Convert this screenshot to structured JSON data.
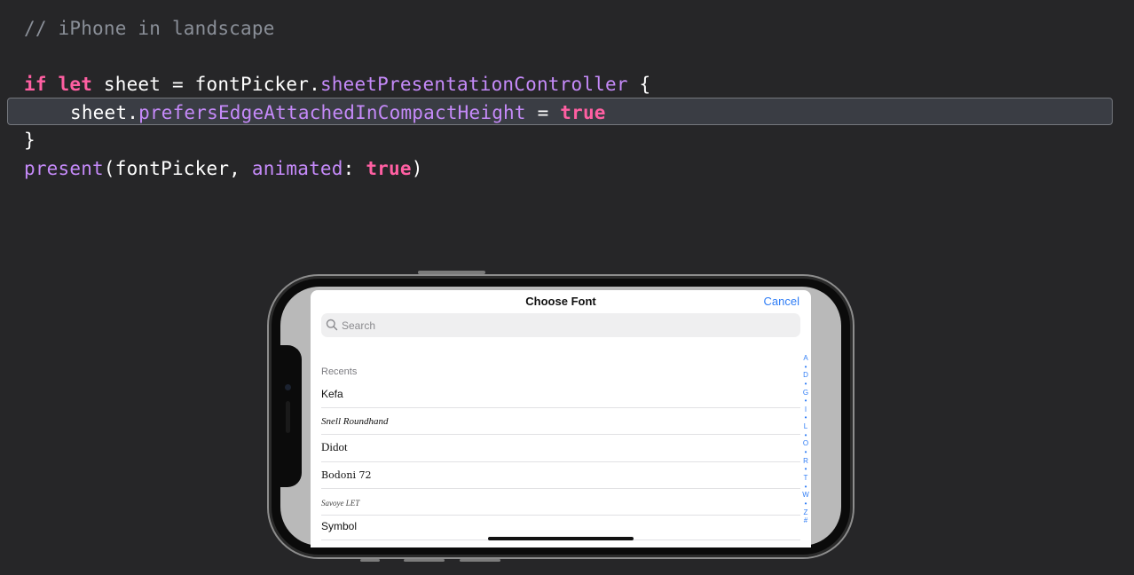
{
  "code": {
    "comment": "// iPhone in landscape",
    "line1": {
      "kw_if": "if",
      "kw_let": "let",
      "sheet": "sheet",
      "eq": "=",
      "fontPicker": "fontPicker.",
      "method": "sheetPresentationController",
      "brace": "{"
    },
    "line2": {
      "receiver": "sheet.",
      "property": "prefersEdgeAttachedInCompactHeight",
      "eq": "=",
      "value": "true"
    },
    "line3": "}",
    "line4": {
      "fn": "present",
      "open": "(fontPicker, ",
      "label": "animated",
      "colon": ": ",
      "value": "true",
      "close": ")"
    }
  },
  "picker": {
    "title": "Choose Font",
    "cancel": "Cancel",
    "search_placeholder": "Search",
    "section": "Recents",
    "fonts": [
      "Kefa",
      "Snell Roundhand",
      "Didot",
      "Bodoni 72",
      "Savoye LET",
      "Symbol"
    ],
    "index": [
      "A",
      "•",
      "D",
      "•",
      "G",
      "•",
      "I",
      "•",
      "L",
      "•",
      "O",
      "•",
      "R",
      "•",
      "T",
      "•",
      "W",
      "•",
      "Z",
      "#"
    ]
  },
  "colors": {
    "background": "#262628",
    "keyword": "#ff5fa2",
    "method": "#c58af9",
    "comment": "#8a8f98",
    "accent": "#2f7df6"
  }
}
